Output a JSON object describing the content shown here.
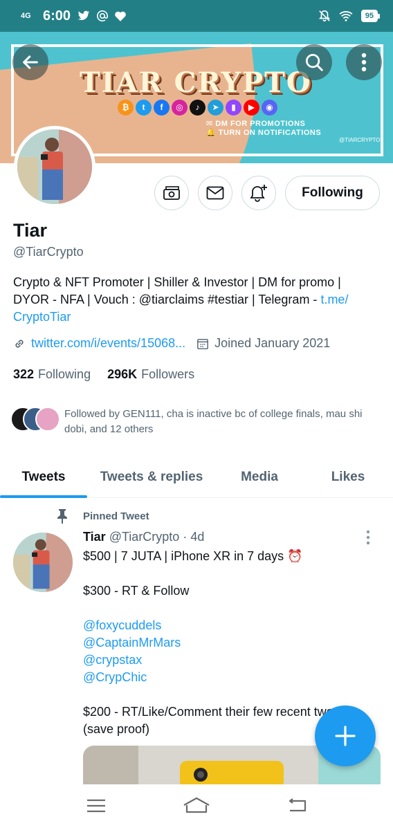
{
  "status_bar": {
    "network": "4G",
    "time": "6:00",
    "battery": "95",
    "icons": [
      "twitter-icon",
      "at-icon",
      "heart-icon",
      "mute-icon",
      "wifi-icon",
      "battery-icon"
    ]
  },
  "banner": {
    "title": "TIAR CRYPTO",
    "line1": "DM FOR PROMOTIONS",
    "line2": "TURN ON NOTIFICATIONS",
    "handle": "@TIARCRYPTO",
    "socials": [
      {
        "icon": "bitcoin-icon",
        "glyph": "₿",
        "color": "#f7931a"
      },
      {
        "icon": "twitter-icon",
        "glyph": "t",
        "color": "#1d9bf0"
      },
      {
        "icon": "facebook-icon",
        "glyph": "f",
        "color": "#1877f2"
      },
      {
        "icon": "instagram-icon",
        "glyph": "◎",
        "color": "#d6249f"
      },
      {
        "icon": "tiktok-icon",
        "glyph": "♪",
        "color": "#111111"
      },
      {
        "icon": "telegram-icon",
        "glyph": "➤",
        "color": "#229ed9"
      },
      {
        "icon": "twitch-icon",
        "glyph": "▮",
        "color": "#9146ff"
      },
      {
        "icon": "youtube-icon",
        "glyph": "▶",
        "color": "#ff0000"
      },
      {
        "icon": "discord-icon",
        "glyph": "◉",
        "color": "#5865f2"
      }
    ]
  },
  "profile": {
    "name": "Tiar",
    "handle": "@TiarCrypto",
    "bio_text": "Crypto & NFT Promoter | Shiller & Investor | DM for promo | DYOR - NFA | Vouch : @tiarclaims #testiar | Telegram - ",
    "bio_link": "t.me/\nCryptoTiar",
    "url": "twitter.com/i/events/15068...",
    "joined": "Joined January 2021",
    "following_count": "322",
    "following_label": "Following",
    "followers_count": "296K",
    "followers_label": "Followers",
    "followed_by": "Followed by GEN111, cha is inactive bc of college finals, mau shi dobi, and 12 others",
    "follow_button": "Following"
  },
  "tabs": [
    {
      "label": "Tweets",
      "active": true
    },
    {
      "label": "Tweets & replies",
      "active": false
    },
    {
      "label": "Media",
      "active": false
    },
    {
      "label": "Likes",
      "active": false
    }
  ],
  "tweet": {
    "pinned_label": "Pinned Tweet",
    "name": "Tiar",
    "handle": "@TiarCrypto",
    "time": "· 4d",
    "line1": "$500 | 7 JUTA | iPhone XR in 7 days ⏰",
    "line2": "$300 - RT & Follow",
    "mentions": [
      "@foxycuddels",
      "@CaptainMrMars",
      "@crypstax",
      "@CrypChic"
    ],
    "line3": "$200 - RT/Like/Comment their few recent tweets",
    "line4": "(save proof)"
  },
  "colors": {
    "accent": "#1d9bf0",
    "status_bar": "#237f86",
    "banner_teal": "#4ec3cf",
    "banner_peach": "#e8b48f"
  }
}
